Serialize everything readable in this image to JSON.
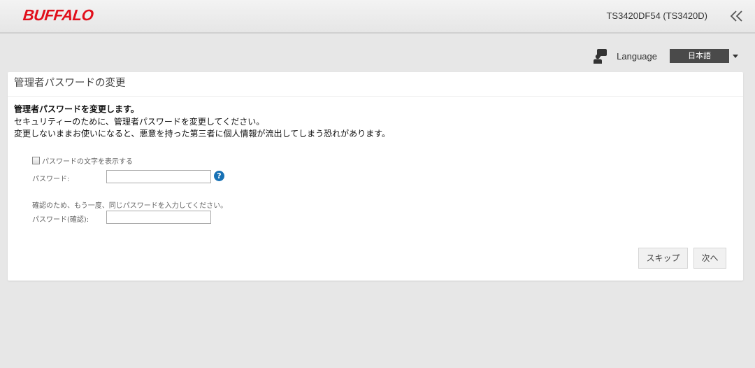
{
  "header": {
    "logo_text": "BUFFALO",
    "model_text": "TS3420DF54 (TS3420D)",
    "collapse_icon": "double-chevron-left-icon"
  },
  "language": {
    "icon": "speech-person-icon",
    "label": "Language",
    "selected": "日本語"
  },
  "panel": {
    "title": "管理者パスワードの変更",
    "intro_heading": "管理者パスワードを変更します。",
    "intro_line1": "セキュリティーのために、管理者パスワードを変更してください。",
    "intro_line2": "変更しないままお使いになると、悪意を持った第三者に個人情報が流出してしまう恐れがあります。",
    "show_password_label": "パスワードの文字を表示する",
    "show_password_checked": false,
    "password_label": "パスワード:",
    "password_value": "",
    "confirm_hint": "確認のため、もう一度、同じパスワードを入力してください。",
    "confirm_label": "パスワード(確認):",
    "confirm_value": "",
    "help_icon": "question-circle-icon",
    "help_symbol": "?",
    "skip_button": "スキップ",
    "next_button": "次へ"
  },
  "colors": {
    "brand": "#e10f1b",
    "help": "#1771b5",
    "language_bg": "#4a4a4a"
  }
}
